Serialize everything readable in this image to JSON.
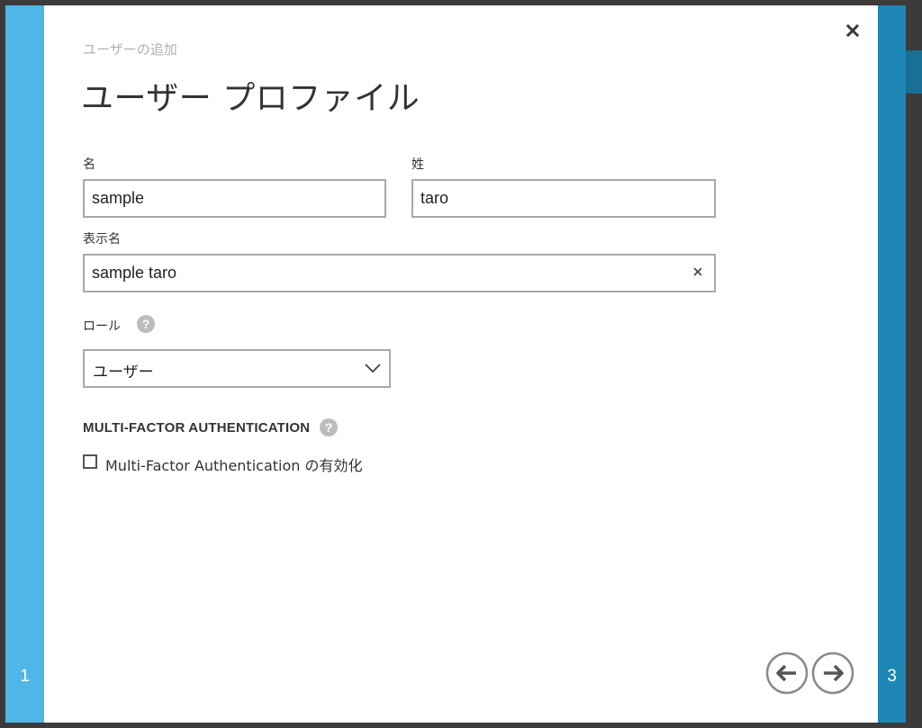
{
  "wizard": {
    "subtitle": "ユーザーの追加",
    "title": "ユーザー プロファイル",
    "current_step_left": "1",
    "current_step_right": "3"
  },
  "form": {
    "first_name": {
      "label": "名",
      "value": "sample"
    },
    "last_name": {
      "label": "姓",
      "value": "taro"
    },
    "display_name": {
      "label": "表示名",
      "value": "sample taro"
    },
    "role": {
      "label": "ロール",
      "selected": "ユーザー"
    },
    "mfa": {
      "heading": "MULTI-FACTOR AUTHENTICATION",
      "checkbox_label": "Multi-Factor Authentication の有効化",
      "checked": false
    }
  },
  "icons": {
    "close": "close-icon",
    "clear": "clear-input-icon",
    "help": "help-icon",
    "chevron": "chevron-down-icon",
    "back": "arrow-left-icon",
    "next": "arrow-right-icon",
    "help_glyph": "?"
  },
  "colors": {
    "step_left": "#4fb6e6",
    "step_right": "#1d86b4",
    "backdrop": "#3b3b3b",
    "input_border": "#a8a8a8"
  }
}
